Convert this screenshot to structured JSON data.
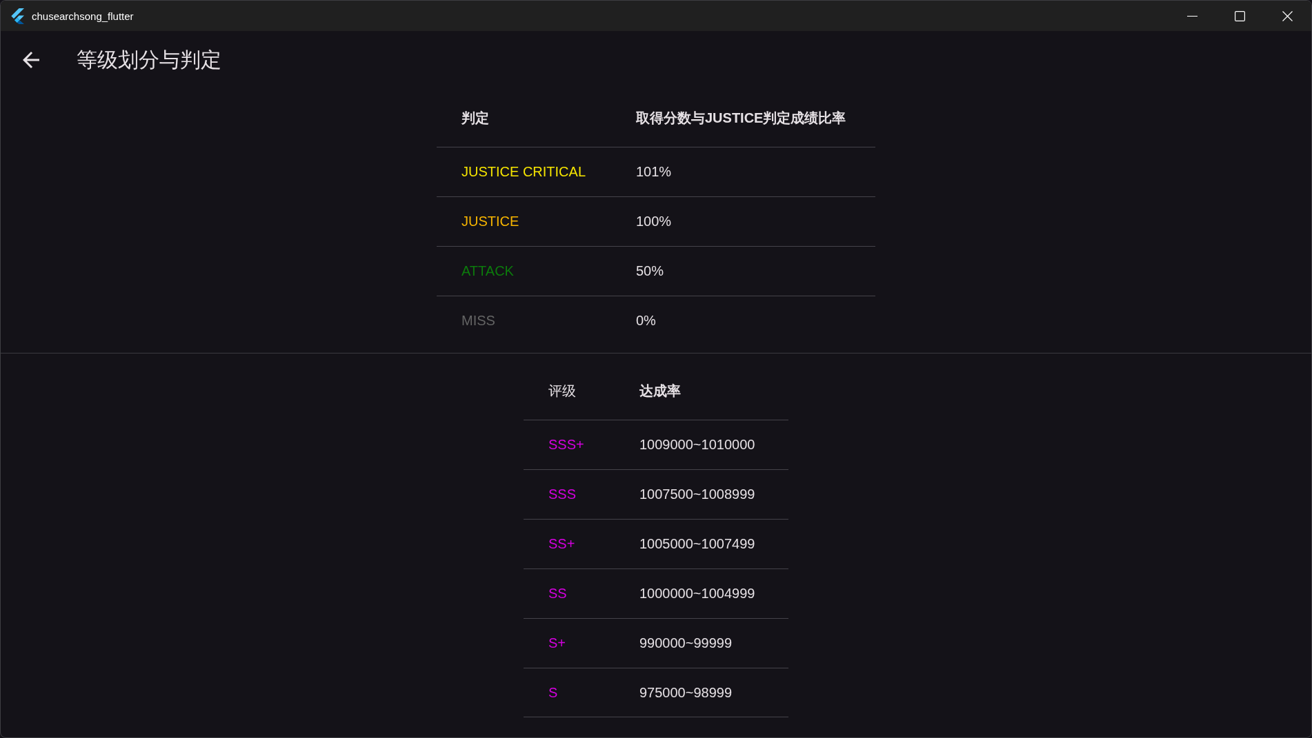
{
  "window": {
    "title": "chusearchsong_flutter"
  },
  "app_bar": {
    "title": "等级划分与判定"
  },
  "judgment_table": {
    "columns": [
      {
        "label": "判定",
        "bold": true
      },
      {
        "label": "取得分数与JUSTICE判定成绩比率",
        "bold": true
      }
    ],
    "rows": [
      {
        "judgment": "JUSTICE CRITICAL",
        "color": "#f5e400",
        "ratio": "101%"
      },
      {
        "judgment": "JUSTICE",
        "color": "#f7b500",
        "ratio": "100%"
      },
      {
        "judgment": "ATTACK",
        "color": "#0c7a0c",
        "ratio": "50%"
      },
      {
        "judgment": "MISS",
        "color": "#646464",
        "ratio": "0%"
      }
    ]
  },
  "rank_table": {
    "columns": [
      {
        "label": "评级",
        "bold": false
      },
      {
        "label": "达成率",
        "bold": true
      }
    ],
    "rows": [
      {
        "rank": "SSS+",
        "score_range": "1009000~1010000"
      },
      {
        "rank": "SSS",
        "score_range": "1007500~1008999"
      },
      {
        "rank": "SS+",
        "score_range": "1005000~1007499"
      },
      {
        "rank": "SS",
        "score_range": "1000000~1004999"
      },
      {
        "rank": "S+",
        "score_range": "990000~99999"
      },
      {
        "rank": "S",
        "score_range": "975000~98999"
      }
    ]
  }
}
